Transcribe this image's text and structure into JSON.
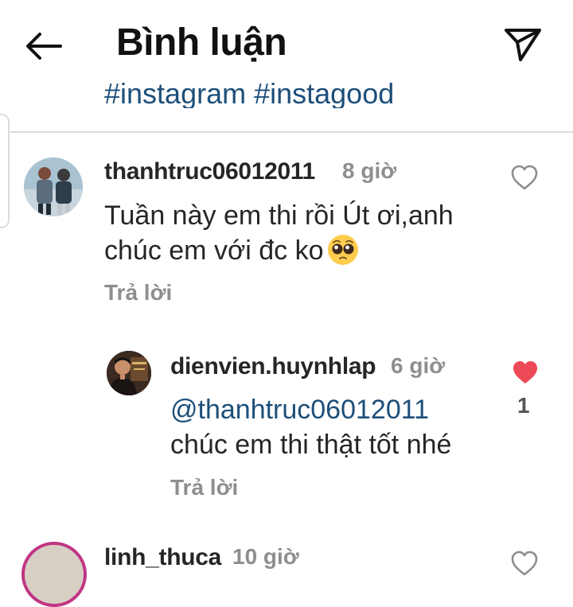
{
  "header": {
    "title": "Bình luận"
  },
  "caption": {
    "hashtags": "#instagram #instagood"
  },
  "comments": [
    {
      "username": "thanhtruc06012011",
      "time": "8 giờ",
      "text": "Tuần này em thi rồi Út ơi,anh chúc em với đc ko",
      "emoji": "pleading-face-emoji",
      "reply_label": "Trả lời",
      "liked": false
    },
    {
      "username": "dienvien.huynhlap",
      "time": "6 giờ",
      "mention": "@thanhtruc06012011",
      "text": "chúc em thi thật tốt nhé",
      "reply_label": "Trả lời",
      "liked": true,
      "like_count": "1"
    },
    {
      "username": "linh_thuca",
      "time": "10 giờ"
    }
  ],
  "colors": {
    "heart_liked": "#ed4956",
    "link": "#1d4f7a",
    "muted": "#8e8e8e"
  },
  "icons": [
    "back-arrow-icon",
    "send-icon",
    "heart-outline-icon",
    "heart-filled-icon"
  ]
}
